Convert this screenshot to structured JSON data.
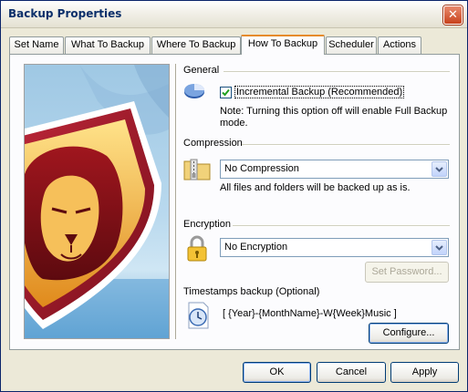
{
  "window": {
    "title": "Backup Properties",
    "close_glyph": "✕"
  },
  "tabs": [
    {
      "label": "Set Name"
    },
    {
      "label": "What To Backup"
    },
    {
      "label": "Where To Backup"
    },
    {
      "label": "How To Backup",
      "active": true
    },
    {
      "label": "Scheduler"
    },
    {
      "label": "Actions"
    }
  ],
  "general": {
    "heading": "General",
    "icon": "pie-chart-icon",
    "checkbox_label": "Incremental Backup (Recommended)",
    "checked": true,
    "note": "Note: Turning this option off will enable Full Backup mode."
  },
  "compression": {
    "heading": "Compression",
    "icon": "zip-folder-icon",
    "selected": "No Compression",
    "description": "All files and folders will be backed up as is."
  },
  "encryption": {
    "heading": "Encryption",
    "icon": "padlock-icon",
    "selected": "No Encryption",
    "set_password_label": "Set Password..."
  },
  "timestamps": {
    "heading": "Timestamps backup (Optional)",
    "icon": "clock-document-icon",
    "pattern": "[ {Year}-{MonthName}-W{Week}Music ]",
    "configure_label": "Configure..."
  },
  "buttons": {
    "ok": "OK",
    "cancel": "Cancel",
    "apply": "Apply"
  },
  "colors": {
    "tab_active_accent": "#e68b2c",
    "select_border": "#7f9db9",
    "button_border": "#003c74"
  }
}
